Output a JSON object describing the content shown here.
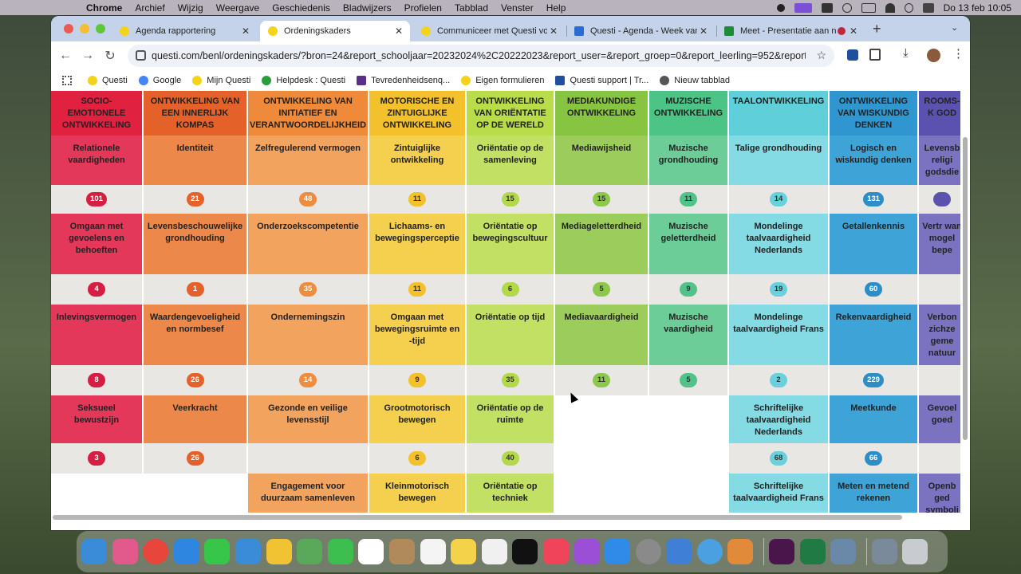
{
  "menubar": {
    "items": [
      "Chrome",
      "Archief",
      "Wijzig",
      "Weergave",
      "Geschiedenis",
      "Bladwijzers",
      "Profielen",
      "Tabblad",
      "Venster",
      "Help"
    ],
    "datetime": "Do 13 feb  10:05"
  },
  "tabs": [
    {
      "title": "Agenda rapportering",
      "color": "#f3d31c",
      "active": false
    },
    {
      "title": "Ordeningskaders",
      "color": "#f3d31c",
      "active": true
    },
    {
      "title": "Communiceer met Questi voo",
      "color": "#f3d31c",
      "active": false
    },
    {
      "title": "Questi - Agenda - Week van 1",
      "color": "#2b6bd6",
      "active": false
    },
    {
      "title": "Meet - Presentatie aan ni",
      "color": "#1f8a3a",
      "active": false
    }
  ],
  "omnibox": {
    "url": "questi.com/benl/ordeningskaders/?bron=24&report_schooljaar=20232024%2C20222023&report_user=&report_groep=0&report_leerling=952&report_ty..."
  },
  "bookmarks": [
    {
      "label": "Questi",
      "color": "#f3d31c"
    },
    {
      "label": "Google",
      "color": "#4285f4"
    },
    {
      "label": "Mijn Questi",
      "color": "#f3d31c"
    },
    {
      "label": "Helpdesk : Questi",
      "color": "#2a9d3a"
    },
    {
      "label": "Tevredenheidsenq...",
      "color": "#5a2f8a"
    },
    {
      "label": "Eigen formulieren",
      "color": "#f3d31c"
    },
    {
      "label": "Questi support | Tr...",
      "color": "#1f4f9e"
    },
    {
      "label": "Nieuw tabblad",
      "color": "#555555"
    }
  ],
  "columns": [
    {
      "header": "SOCIO-EMOTIONELE ONTWIKKELING",
      "hdr": "#e0213f",
      "light": "#e3385a",
      "pill": "#d61e43",
      "pillText": "#ffffff",
      "rows": [
        {
          "label": "Relationele vaardigheden",
          "count": "101"
        },
        {
          "label": "Omgaan met gevoelens en behoeften",
          "count": "4"
        },
        {
          "label": "Inlevingsvermogen",
          "count": "8"
        },
        {
          "label": "Seksueel bewustzijn",
          "count": "3"
        },
        {
          "label": "",
          "count": ""
        }
      ]
    },
    {
      "header": "ONTWIKKELING VAN EEN INNERLIJK KOMPAS",
      "hdr": "#e4622a",
      "light": "#ec8849",
      "pill": "#e4622a",
      "pillText": "#ffffff",
      "rows": [
        {
          "label": "Identiteit",
          "count": "21"
        },
        {
          "label": "Levensbeschouwelijke grondhouding",
          "count": "1"
        },
        {
          "label": "Waardengevoeligheid en normbesef",
          "count": "26"
        },
        {
          "label": "Veerkracht",
          "count": "26"
        },
        {
          "label": "",
          "count": ""
        }
      ]
    },
    {
      "header": "ONTWIKKELING VAN INITIATIEF EN VERANTWOORDELIJKHEID",
      "hdr": "#ef8a3a",
      "light": "#f2a45f",
      "pill": "#ee8c3f",
      "pillText": "#ffffff",
      "rows": [
        {
          "label": "Zelfregulerend vermogen",
          "count": "48"
        },
        {
          "label": "Onderzoekscompetentie",
          "count": "35"
        },
        {
          "label": "Ondernemingszin",
          "count": "14"
        },
        {
          "label": "Gezonde en veilige levensstijl",
          "count": ""
        },
        {
          "label": "Engagement voor duurzaam samenleven",
          "count": ""
        }
      ]
    },
    {
      "header": "MOTORISCHE EN ZINTUIGLIJKE ONTWIKKELING",
      "hdr": "#f2c12b",
      "light": "#f5cf4e",
      "pill": "#f2c12b",
      "pillText": "#333333",
      "rows": [
        {
          "label": "Zintuiglijke ontwikkeling",
          "count": "11"
        },
        {
          "label": "Lichaams- en bewegingsperceptie",
          "count": "11"
        },
        {
          "label": "Omgaan met bewegingsruimte en -tijd",
          "count": "9"
        },
        {
          "label": "Grootmotorisch bewegen",
          "count": "6"
        },
        {
          "label": "Kleinmotorisch bewegen",
          "count": ""
        }
      ]
    },
    {
      "header": "ONTWIKKELING VAN ORIËNTATIE OP DE WERELD",
      "hdr": "#b8dc4a",
      "light": "#c2e064",
      "pill": "#b3d84a",
      "pillText": "#333333",
      "rows": [
        {
          "label": "Oriëntatie op de samenleving",
          "count": "15"
        },
        {
          "label": "Oriëntatie op bewegingscultuur",
          "count": "6"
        },
        {
          "label": "Oriëntatie op tijd",
          "count": "35"
        },
        {
          "label": "Oriëntatie op de ruimte",
          "count": "40"
        },
        {
          "label": "Oriëntatie op techniek",
          "count": ""
        }
      ]
    },
    {
      "header": "MEDIAKUNDIGE ONTWIKKELING",
      "hdr": "#86c441",
      "light": "#9ccd5c",
      "pill": "#8bc84c",
      "pillText": "#333333",
      "rows": [
        {
          "label": "Mediawijsheid",
          "count": "15"
        },
        {
          "label": "Mediageletterdheid",
          "count": "5"
        },
        {
          "label": "Mediavaardigheid",
          "count": "11"
        },
        {
          "label": "",
          "count": ""
        },
        {
          "label": "",
          "count": ""
        }
      ]
    },
    {
      "header": "MUZISCHE ONTWIKKELING",
      "hdr": "#4cc486",
      "light": "#6ccd98",
      "pill": "#52c28a",
      "pillText": "#333333",
      "rows": [
        {
          "label": "Muzische grondhouding",
          "count": "11"
        },
        {
          "label": "Muzische geletterdheid",
          "count": "9"
        },
        {
          "label": "Muzische vaardigheid",
          "count": "5"
        },
        {
          "label": "",
          "count": ""
        },
        {
          "label": "",
          "count": ""
        }
      ]
    },
    {
      "header": "TAALONTWIKKELING",
      "hdr": "#5fcfda",
      "light": "#85dbe3",
      "pill": "#6ad1dc",
      "pillText": "#333333",
      "rows": [
        {
          "label": "Talige grondhouding",
          "count": "14"
        },
        {
          "label": "Mondelinge taalvaardigheid Nederlands",
          "count": "19"
        },
        {
          "label": "Mondelinge taalvaardigheid Frans",
          "count": "2"
        },
        {
          "label": "Schriftelijke taalvaardigheid Nederlands",
          "count": "68"
        },
        {
          "label": "Schriftelijke taalvaardigheid Frans",
          "count": ""
        }
      ]
    },
    {
      "header": "ONTWIKKELING VAN WISKUNDIG DENKEN",
      "hdr": "#2f96cf",
      "light": "#3ea3d6",
      "pill": "#2d8ec7",
      "pillText": "#ffffff",
      "rows": [
        {
          "label": "Logisch en wiskundig denken",
          "count": "131"
        },
        {
          "label": "Getallenkennis",
          "count": "60"
        },
        {
          "label": "Rekenvaardigheid",
          "count": "229"
        },
        {
          "label": "Meetkunde",
          "count": "66"
        },
        {
          "label": "Meten en metend rekenen",
          "count": ""
        }
      ]
    },
    {
      "header": "ROOMS-K GOD",
      "hdr": "#5b52b0",
      "light": "#7b72c0",
      "pill": "#5b52b0",
      "pillText": "#ffffff",
      "rows": [
        {
          "label": "Levensb religi godsdie",
          "count": " "
        },
        {
          "label": "Vertr wan mogel bepe",
          "count": ""
        },
        {
          "label": "Verbon zichze geme natuur",
          "count": ""
        },
        {
          "label": "Gevoel goed",
          "count": ""
        },
        {
          "label": "Openb ged symboli",
          "count": ""
        }
      ]
    }
  ]
}
